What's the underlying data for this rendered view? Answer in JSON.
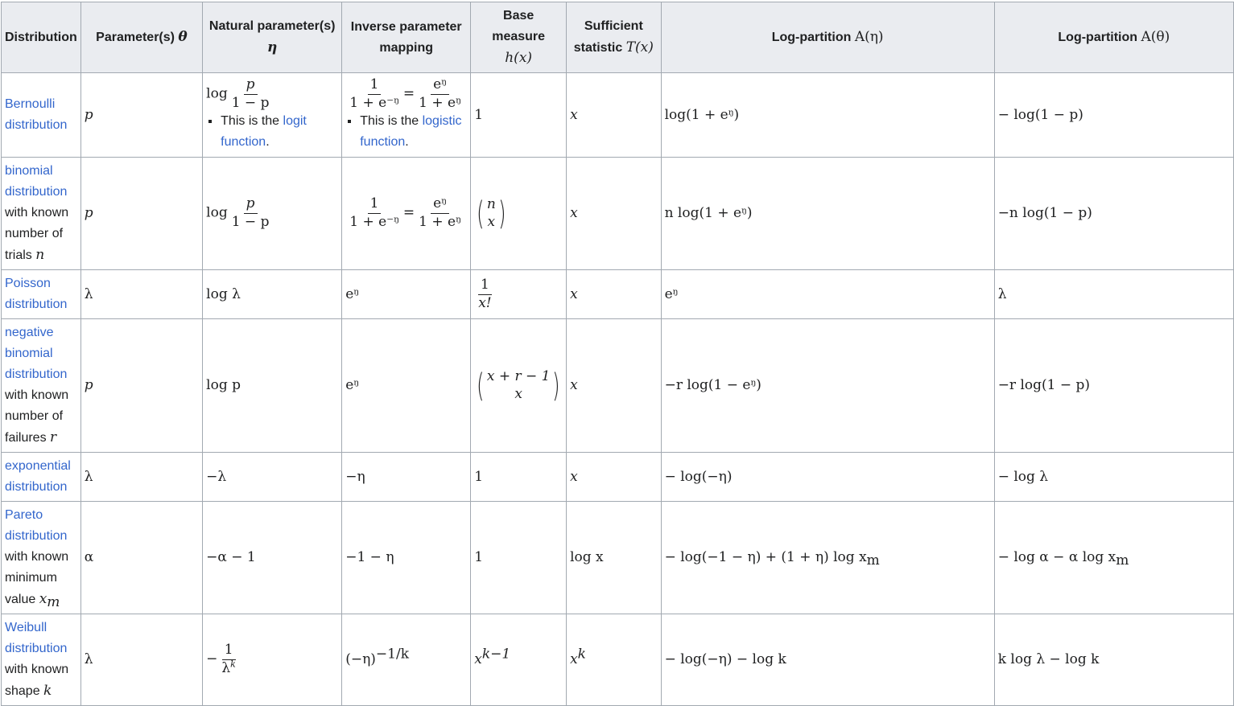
{
  "headers": {
    "distribution": "Distribution",
    "params": "Parameter(s)",
    "params_sym": "θ",
    "natural": "Natural parameter(s)",
    "natural_sym": "η",
    "inverse": "Inverse parameter mapping",
    "base_top": "Base",
    "base_mid": "measure",
    "base_sym": "h(x)",
    "suff_top": "Sufficient",
    "suff_mid": "statistic",
    "suff_sym": "T(x)",
    "logA_eta": "Log-partition",
    "logA_eta_sym": "A(η)",
    "logA_theta": "Log-partition",
    "logA_theta_sym": "A(θ)"
  },
  "rows": {
    "bernoulli": {
      "link": "Bernoulli distribution",
      "param": "p",
      "nat_log": "log",
      "nat_num": "p",
      "nat_den": "1 − p",
      "nat_note_pre": "This is the",
      "nat_note_link": "logit function",
      "nat_note_post": ".",
      "inv_num1": "1",
      "inv_den1": "1 + e⁻ᵑ",
      "inv_eq": "=",
      "inv_num2": "eᵑ",
      "inv_den2": "1 + eᵑ",
      "inv_note_pre": "This is the",
      "inv_note_link": "logistic function",
      "inv_note_post": ".",
      "base": "1",
      "suff": "x",
      "logA_eta": "log(1 + eᵑ)",
      "logA_theta": "− log(1 − p)"
    },
    "binomial": {
      "link": "binomial distribution",
      "text": "with known number of trials",
      "sym": "n",
      "param": "p",
      "nat_log": "log",
      "nat_num": "p",
      "nat_den": "1 − p",
      "inv_num1": "1",
      "inv_den1": "1 + e⁻ᵑ",
      "inv_eq": "=",
      "inv_num2": "eᵑ",
      "inv_den2": "1 + eᵑ",
      "base_top": "n",
      "base_bot": "x",
      "suff": "x",
      "logA_eta": "n log(1 + eᵑ)",
      "logA_theta": "−n log(1 − p)"
    },
    "poisson": {
      "link": "Poisson distribution",
      "param": "λ",
      "natural": "log λ",
      "inverse": "eᵑ",
      "base_num": "1",
      "base_den": "x!",
      "suff": "x",
      "logA_eta": "eᵑ",
      "logA_theta": "λ"
    },
    "negbinomial": {
      "link": "negative binomial distribution",
      "text": "with known number of failures",
      "sym": "r",
      "param": "p",
      "natural": "log p",
      "inverse": "eᵑ",
      "base_top": "x + r − 1",
      "base_bot": "x",
      "suff": "x",
      "logA_eta": "−r log(1 − eᵑ)",
      "logA_theta": "−r log(1 − p)"
    },
    "exponential": {
      "link": "exponential distribution",
      "param": "λ",
      "natural": "−λ",
      "inverse": "−η",
      "base": "1",
      "suff": "x",
      "logA_eta": "− log(−η)",
      "logA_theta": "− log λ"
    },
    "pareto": {
      "link": "Pareto distribution",
      "text": "with known minimum value",
      "sym": "x",
      "sym_sub": "m",
      "param": "α",
      "natural": "−α − 1",
      "inverse": "−1 − η",
      "base": "1",
      "suff": "log x",
      "logA_eta_main": "− log(−1 − η) + (1 + η) log x",
      "logA_eta_sub": "m",
      "logA_theta_main": "− log α − α log x",
      "logA_theta_sub": "m"
    },
    "weibull": {
      "link": "Weibull distribution",
      "text": "with known shape",
      "sym": "k",
      "param": "λ",
      "nat_sign": "−",
      "nat_num": "1",
      "nat_den_base": "λ",
      "nat_den_sup": "k",
      "inv_base": "(−η)",
      "inv_sup": "−1/k",
      "base_base": "x",
      "base_sup": "k−1",
      "suff_base": "x",
      "suff_sup": "k",
      "logA_eta": "− log(−η) − log k",
      "logA_theta": "k log λ − log k"
    }
  }
}
